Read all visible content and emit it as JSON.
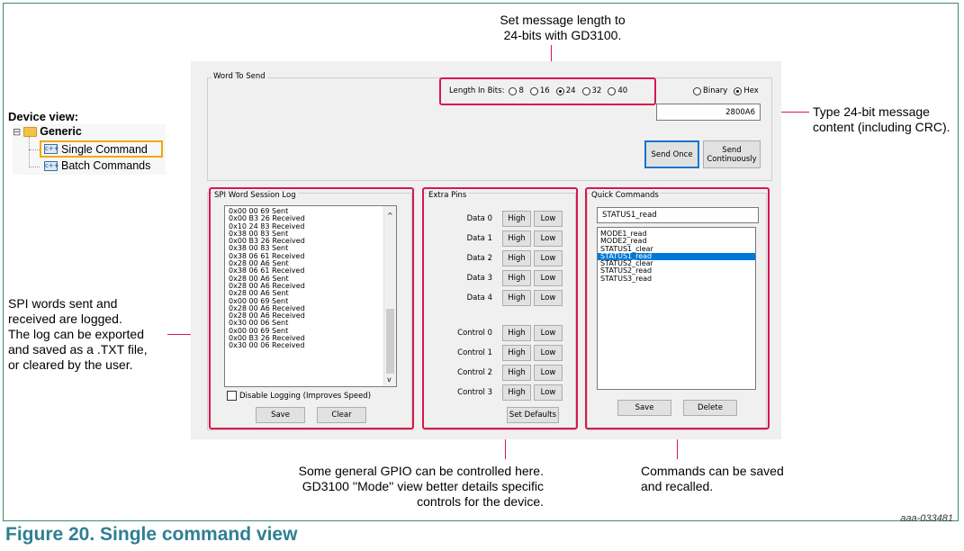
{
  "figure": {
    "caption": "Figure 20.  Single command view",
    "figure_id": "aaa-033481"
  },
  "device_view": {
    "heading": "Device view:",
    "tree": [
      {
        "label": "Generic",
        "icon": "folder-icon",
        "expander": "⊟"
      },
      {
        "label": "Single Command",
        "icon": "command-icon",
        "selected": true
      },
      {
        "label": "Batch Commands",
        "icon": "command-icon",
        "selected": false
      }
    ]
  },
  "callouts": {
    "length": [
      "Set message length to",
      "24-bits with GD3100."
    ],
    "content": [
      "Type 24-bit message",
      "content (including CRC)."
    ],
    "log": [
      "SPI words sent and",
      "received are logged.",
      "The log can be exported",
      "and saved as a .TXT file,",
      "or cleared by the user."
    ],
    "gpio": [
      "Some general GPIO can be controlled here.",
      "GD3100 ''Mode'' view better details specific",
      "controls for the device."
    ],
    "commands": [
      "Commands can be saved",
      "and recalled."
    ]
  },
  "word_to_send": {
    "group_label": "Word To Send",
    "length_label": "Length In Bits:",
    "length_options": [
      "8",
      "16",
      "24",
      "32",
      "40"
    ],
    "length_selected": "24",
    "format_options": [
      "Binary",
      "Hex"
    ],
    "format_selected": "Hex",
    "value": "2800A6",
    "send_once_label": "Send Once",
    "send_continuously_label": "Send Continuously"
  },
  "log": {
    "group_label": "SPI Word Session Log",
    "entries": [
      "0x00 00 69 Sent",
      "0x00 B3 26 Received",
      "0x10 24 83 Received",
      "0x38 00 83 Sent",
      "0x00 B3 26 Received",
      "0x38 00 83 Sent",
      "0x38 06 61 Received",
      "0x28 00 A6 Sent",
      "0x38 06 61 Received",
      "0x28 00 A6 Sent",
      "0x28 00 A6 Received",
      "0x28 00 A6 Sent",
      "0x00 00 69 Sent",
      "0x28 00 A6 Received",
      "0x28 00 A6 Received",
      "0x30 00 06 Sent",
      "0x00 00 69 Sent",
      "0x00 B3 26 Received",
      "0x30 00 06 Received"
    ],
    "disable_logging_label": "Disable Logging (Improves Speed)",
    "disable_logging_checked": false,
    "save_label": "Save",
    "clear_label": "Clear"
  },
  "extra_pins": {
    "group_label": "Extra Pins",
    "data_pins": [
      "Data 0",
      "Data 1",
      "Data 2",
      "Data 3",
      "Data 4"
    ],
    "control_pins": [
      "Control 0",
      "Control 1",
      "Control 2",
      "Control 3"
    ],
    "high_label": "High",
    "low_label": "Low",
    "set_defaults_label": "Set Defaults"
  },
  "quick_commands": {
    "group_label": "Quick Commands",
    "input_value": "STATUS1_read",
    "items": [
      "MODE1_read",
      "MODE2_read",
      "STATUS1_clear",
      "STATUS1_read",
      "STATUS2_clear",
      "STATUS2_read",
      "STATUS3_read"
    ],
    "selected": "STATUS1_read",
    "save_label": "Save",
    "delete_label": "Delete"
  },
  "colors": {
    "highlight": "#d8174e",
    "caption": "#2f7f93",
    "selection": "#0078d7",
    "tree_highlight": "#f2a900"
  }
}
